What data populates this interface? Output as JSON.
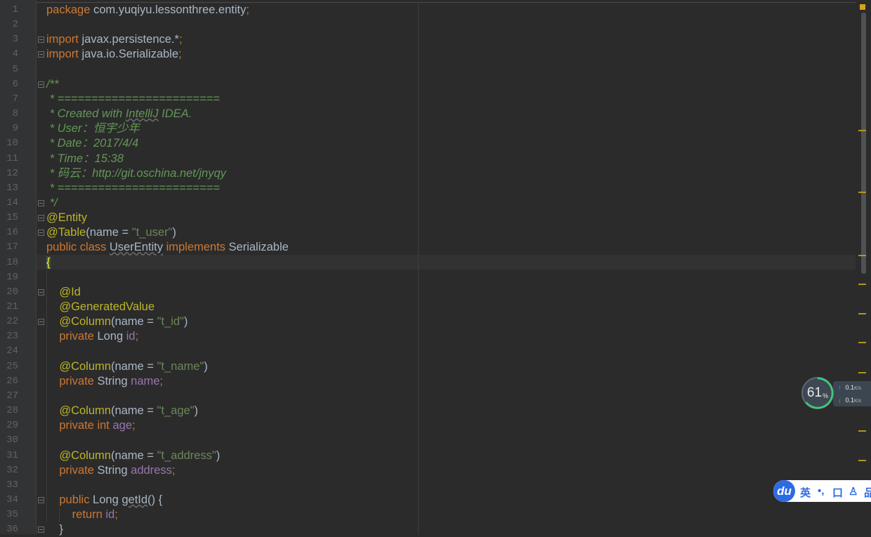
{
  "editor": {
    "line_numbers": [
      "1",
      "2",
      "3",
      "4",
      "5",
      "6",
      "7",
      "8",
      "9",
      "10",
      "11",
      "12",
      "13",
      "14",
      "15",
      "16",
      "17",
      "18",
      "19",
      "20",
      "21",
      "22",
      "23",
      "24",
      "25",
      "26",
      "27",
      "28",
      "29",
      "30",
      "31",
      "32",
      "33",
      "34",
      "35",
      "36"
    ],
    "lines": [
      [
        [
          "kw",
          "package "
        ],
        [
          "plain",
          "com.yuqiyu.lessonthree.entity"
        ],
        [
          "kw",
          ";"
        ]
      ],
      [],
      [
        [
          "kw",
          "import "
        ],
        [
          "plain",
          "javax.persistence.*"
        ],
        [
          "kw",
          ";"
        ]
      ],
      [
        [
          "kw",
          "import "
        ],
        [
          "plain",
          "java.io.Serializable"
        ],
        [
          "kw",
          ";"
        ]
      ],
      [],
      [
        [
          "cmt",
          "/**"
        ]
      ],
      [
        [
          "cmt",
          " * ========================"
        ]
      ],
      [
        [
          "cmt",
          " * Created with "
        ],
        [
          "cmt wavy",
          "IntelliJ"
        ],
        [
          "cmt",
          " IDEA."
        ]
      ],
      [
        [
          "cmt",
          " * User：恒宇少年"
        ]
      ],
      [
        [
          "cmt",
          " * Date：2017/4/4"
        ]
      ],
      [
        [
          "cmt",
          " * Time：15:38"
        ]
      ],
      [
        [
          "cmt",
          " * 码云：http://git.oschina.net/jnyqy"
        ]
      ],
      [
        [
          "cmt",
          " * ========================"
        ]
      ],
      [
        [
          "cmt",
          " */"
        ]
      ],
      [
        [
          "ann",
          "@Entity"
        ]
      ],
      [
        [
          "ann",
          "@Table"
        ],
        [
          "plain",
          "(name = "
        ],
        [
          "str",
          "\"t_user\""
        ],
        [
          "plain",
          ")"
        ]
      ],
      [
        [
          "kw",
          "public class "
        ],
        [
          "plain wavy",
          "UserEntity"
        ],
        [
          "kw",
          " implements "
        ],
        [
          "plain",
          "Serializable"
        ]
      ],
      [
        [
          "brace-hl",
          "{"
        ]
      ],
      [],
      [
        [
          "ann",
          "    @Id"
        ]
      ],
      [
        [
          "ann",
          "    @GeneratedValue"
        ]
      ],
      [
        [
          "ann",
          "    @Column"
        ],
        [
          "plain",
          "(name = "
        ],
        [
          "str",
          "\"t_id\""
        ],
        [
          "plain",
          ")"
        ]
      ],
      [
        [
          "kw",
          "    private "
        ],
        [
          "plain",
          "Long "
        ],
        [
          "fld",
          "id"
        ],
        [
          "kw",
          ";"
        ]
      ],
      [],
      [
        [
          "ann",
          "    @Column"
        ],
        [
          "plain",
          "(name = "
        ],
        [
          "str",
          "\"t_name\""
        ],
        [
          "plain",
          ")"
        ]
      ],
      [
        [
          "kw",
          "    private "
        ],
        [
          "plain",
          "String "
        ],
        [
          "fld",
          "name"
        ],
        [
          "kw",
          ";"
        ]
      ],
      [],
      [
        [
          "ann",
          "    @Column"
        ],
        [
          "plain",
          "(name = "
        ],
        [
          "str",
          "\"t_age\""
        ],
        [
          "plain",
          ")"
        ]
      ],
      [
        [
          "kw",
          "    private int "
        ],
        [
          "fld",
          "age"
        ],
        [
          "kw",
          ";"
        ]
      ],
      [],
      [
        [
          "ann",
          "    @Column"
        ],
        [
          "plain",
          "(name = "
        ],
        [
          "str",
          "\"t_address\""
        ],
        [
          "plain",
          ")"
        ]
      ],
      [
        [
          "kw",
          "    private "
        ],
        [
          "plain",
          "String "
        ],
        [
          "fld",
          "address"
        ],
        [
          "kw",
          ";"
        ]
      ],
      [],
      [
        [
          "kw",
          "    public "
        ],
        [
          "plain",
          "Long "
        ],
        [
          "plain wavy",
          "getId"
        ],
        [
          "plain",
          "() {"
        ]
      ],
      [
        [
          "kw",
          "        return "
        ],
        [
          "fld",
          "id"
        ],
        [
          "kw",
          ";"
        ]
      ],
      [
        [
          "plain",
          "    }"
        ]
      ]
    ]
  },
  "net_widget": {
    "percent": "61",
    "percent_sign": "%",
    "upload_value": "0.1",
    "download_value": "0.1",
    "speed_unit": "K/s",
    "up_arrow": "↑",
    "down_arrow": "↓"
  },
  "ime": {
    "logo": "du",
    "mode_label": "英",
    "punct_label": "•,",
    "items": [
      "口",
      "♙",
      "品"
    ]
  },
  "colors": {
    "background": "#2b2b2b",
    "keyword": "#cc7832",
    "annotation": "#bbb529",
    "string": "#6a8759",
    "comment": "#629755",
    "field": "#9876aa",
    "plain": "#a9b7c6"
  }
}
